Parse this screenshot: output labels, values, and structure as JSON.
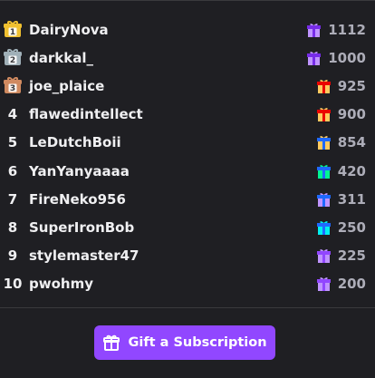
{
  "leaderboard": {
    "entries": [
      {
        "rank": "1",
        "medal": "gold",
        "name": "DairyNova",
        "amount": "1112",
        "gift_color": "#bf94ff",
        "gift_color2": "#772ce8"
      },
      {
        "rank": "2",
        "medal": "silver",
        "name": "darkkal_",
        "amount": "1000",
        "gift_color": "#bf94ff",
        "gift_color2": "#772ce8"
      },
      {
        "rank": "3",
        "medal": "bronze",
        "name": "joe_plaice",
        "amount": "925",
        "gift_color": "#ffca5f",
        "gift_color2": "#eb0400"
      },
      {
        "rank": "4",
        "medal": "",
        "name": "flawedintellect",
        "amount": "900",
        "gift_color": "#ffca5f",
        "gift_color2": "#eb0400"
      },
      {
        "rank": "5",
        "medal": "",
        "name": "LeDutchBoii",
        "amount": "854",
        "gift_color": "#ffca5f",
        "gift_color2": "#1f69ff"
      },
      {
        "rank": "6",
        "medal": "",
        "name": "YanYanyaaaa",
        "amount": "420",
        "gift_color": "#00f593",
        "gift_color2": "#1f69ff"
      },
      {
        "rank": "7",
        "medal": "",
        "name": "FireNeko956",
        "amount": "311",
        "gift_color": "#bf94ff",
        "gift_color2": "#1f69ff"
      },
      {
        "rank": "8",
        "medal": "",
        "name": "SuperIronBob",
        "amount": "250",
        "gift_color": "#00f0f0",
        "gift_color2": "#1f69ff"
      },
      {
        "rank": "9",
        "medal": "",
        "name": "stylemaster47",
        "amount": "225",
        "gift_color": "#bf94ff",
        "gift_color2": "#9147ff"
      },
      {
        "rank": "10",
        "medal": "",
        "name": "pwohmy",
        "amount": "200",
        "gift_color": "#bf94ff",
        "gift_color2": "#9147ff"
      }
    ]
  },
  "gift_button": {
    "label": "Gift a Subscription",
    "icon": "gift-icon",
    "color": "#9147ff"
  },
  "colors": {
    "background": "#1f1f23",
    "text": "#efeff1",
    "muted": "#adadb8",
    "gold": "#f0c030",
    "silver": "#a0b0b8",
    "bronze": "#d08a60"
  }
}
